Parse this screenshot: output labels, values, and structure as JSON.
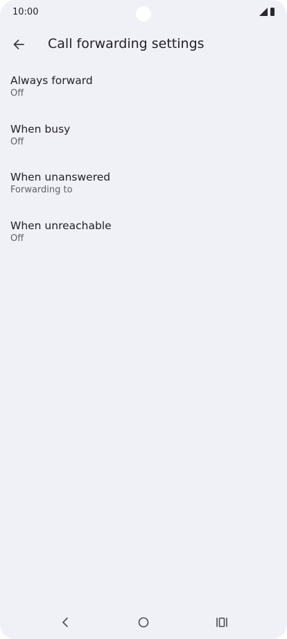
{
  "status_bar": {
    "time": "10:00",
    "icons": [
      "signal-icon",
      "battery-icon"
    ]
  },
  "app_bar": {
    "back_icon": "arrow-back-icon",
    "title": "Call forwarding settings"
  },
  "settings": {
    "items": [
      {
        "title": "Always forward",
        "summary": "Off"
      },
      {
        "title": "When busy",
        "summary": "Off"
      },
      {
        "title": "When unanswered",
        "summary": "Forwarding to"
      },
      {
        "title": "When unreachable",
        "summary": "Off"
      }
    ]
  },
  "nav_bar": {
    "icons": [
      "nav-back-icon",
      "nav-home-icon",
      "nav-recents-icon"
    ]
  },
  "colors": {
    "background": "#f0f0f7",
    "text_primary": "#1f1f24",
    "text_secondary": "#5f5f66"
  }
}
